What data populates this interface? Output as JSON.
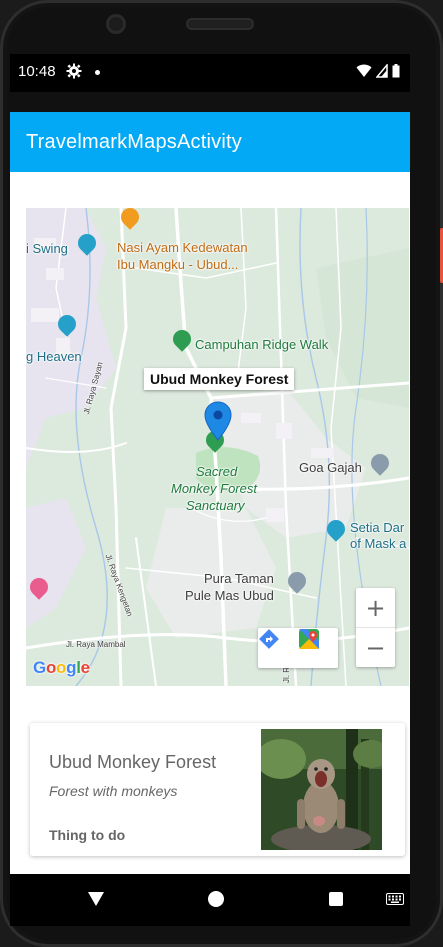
{
  "status_bar": {
    "time": "10:48",
    "icons": [
      "gear-icon",
      "notification-dot-icon",
      "wifi-icon",
      "signal-icon",
      "battery-icon"
    ]
  },
  "app_bar": {
    "title": "TravelmarkMapsActivity",
    "color": "#03a9f4"
  },
  "map": {
    "info_window": "Ubud Monkey Forest",
    "marker_color": "#1e88e5",
    "labels": {
      "nasi_ayam_1": "Nasi Ayam Kedewatan",
      "nasi_ayam_2": "Ibu Mangku -  Ubud...",
      "swing": "i Swing",
      "heaven": "g Heaven",
      "campuhan": "Campuhan Ridge Walk",
      "sacred_1": "Sacred",
      "sacred_2": "Monkey Forest",
      "sacred_3": "Sanctuary",
      "goa_gajah": "Goa Gajah",
      "setia_1": "Setia Dar",
      "setia_2": "of Mask a",
      "pura_1": "Pura Taman",
      "pura_2": "Pule Mas Ubud",
      "road_sayan": "Jl. Raya Sayan",
      "road_kengetan": "Jl. Raya Kengetan",
      "road_mambal": "Jl. Raya Mambal",
      "road_tegal": "Jl. Raya Tegal"
    },
    "zoom_in": "+",
    "zoom_out": "−",
    "google_logo": [
      "G",
      "o",
      "o",
      "g",
      "l",
      "e"
    ],
    "google_colors": [
      "#4285f4",
      "#ea4335",
      "#fbbc05",
      "#4285f4",
      "#34a853",
      "#ea4335"
    ],
    "tools": [
      "directions-icon",
      "google-maps-icon"
    ]
  },
  "card": {
    "title": "Ubud Monkey Forest",
    "subtitle": "Forest with monkeys",
    "category": "Thing to do"
  },
  "nav_bar": {
    "buttons": [
      "back-icon",
      "home-icon",
      "recents-icon",
      "keyboard-icon"
    ]
  }
}
